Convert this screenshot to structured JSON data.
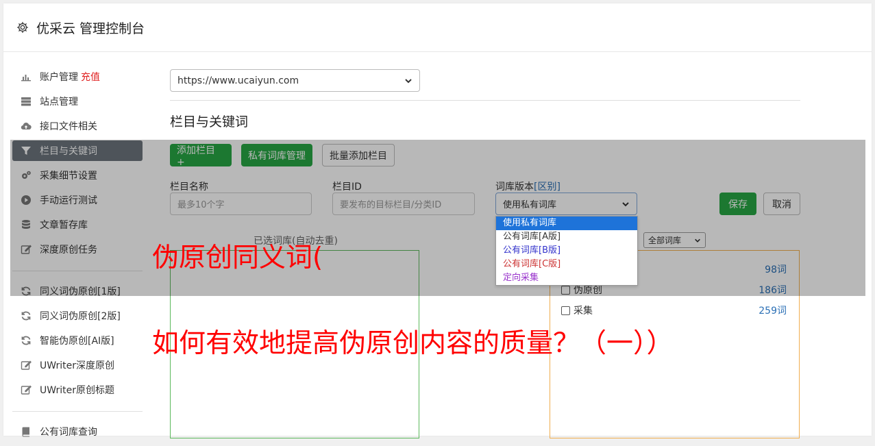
{
  "header": {
    "title": "优采云 管理控制台",
    "icon": "gear-icon"
  },
  "sidebar": {
    "items": [
      {
        "label": "账户管理",
        "badge": "充值",
        "icon": "bar-chart-icon"
      },
      {
        "label": "站点管理",
        "icon": "server-icon"
      },
      {
        "label": "接口文件相关",
        "icon": "cloud-upload-icon"
      },
      {
        "label": "栏目与关键词",
        "icon": "filter-icon",
        "active": true
      },
      {
        "label": "采集细节设置",
        "icon": "gears-icon"
      },
      {
        "label": "手动运行测试",
        "icon": "play-icon"
      },
      {
        "label": "文章暂存库",
        "icon": "database-icon"
      },
      {
        "label": "深度原创任务",
        "icon": "edit-icon"
      }
    ],
    "items2": [
      {
        "label": "同义词伪原创[1版]",
        "icon": "refresh-icon"
      },
      {
        "label": "同义词伪原创[2版]",
        "icon": "refresh-icon"
      },
      {
        "label": "智能伪原创[AI版]",
        "icon": "refresh-icon"
      },
      {
        "label": "UWriter深度原创",
        "icon": "edit-icon"
      },
      {
        "label": "UWriter原创标题",
        "icon": "edit-icon"
      }
    ],
    "items3": [
      {
        "label": "公有词库查询",
        "icon": "book-icon"
      }
    ]
  },
  "main": {
    "site_select": "https://www.ucaiyun.com",
    "section_title": "栏目与关键词",
    "buttons": {
      "add_column": "添加栏目 +",
      "private_lib": "私有词库管理",
      "batch_add": "批量添加栏目",
      "save": "保存",
      "cancel": "取消"
    },
    "form": {
      "name_label": "栏目名称",
      "name_placeholder": "最多10个字",
      "id_label": "栏目ID",
      "id_placeholder": "要发布的目标栏目/分类ID",
      "lib_label": "词库版本",
      "lib_diff": "[区别]",
      "lib_selected": "使用私有词库",
      "lib_options": [
        {
          "label": "使用私有词库",
          "color": "#ffffff"
        },
        {
          "label": "公有词库[A版]",
          "color": "#333333"
        },
        {
          "label": "公有词库[B版]",
          "color": "#3333cc"
        },
        {
          "label": "公有词库[C版]",
          "color": "#cc3333"
        },
        {
          "label": "定向采集",
          "color": "#9933cc"
        }
      ]
    },
    "selected_caption": "已选词库(自动去重)",
    "filter_select": "全部词库",
    "libs": [
      {
        "label": "",
        "count": "98词"
      },
      {
        "label": "伪原创",
        "count": "186词"
      },
      {
        "label": "采集",
        "count": "259词"
      }
    ]
  },
  "overlay_text": {
    "line1": "伪原创同义词(",
    "line2": "如何有效地提高伪原创内容的质量？（一））"
  }
}
